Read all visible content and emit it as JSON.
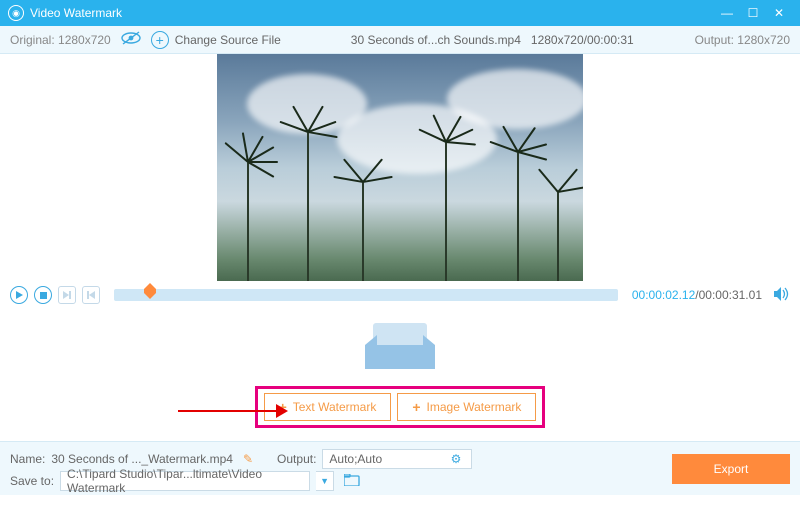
{
  "titlebar": {
    "title": "Video Watermark"
  },
  "infobar": {
    "original": "Original:  1280x720",
    "change_source": "Change Source File",
    "filename": "30 Seconds of...ch Sounds.mp4",
    "resolution_duration": "1280x720/00:00:31",
    "output": "Output:  1280x720"
  },
  "controls": {
    "current_time": "00:00:02.12",
    "total_time": "/00:00:31.01"
  },
  "watermark": {
    "text_btn": "Text Watermark",
    "image_btn": "Image Watermark"
  },
  "bottom": {
    "name_label": "Name:",
    "name_value": "30 Seconds of ..._Watermark.mp4",
    "output_label": "Output:",
    "output_value": "Auto;Auto",
    "saveto_label": "Save to:",
    "saveto_value": "C:\\Tipard Studio\\Tipar...ltimate\\Video Watermark",
    "export": "Export"
  }
}
